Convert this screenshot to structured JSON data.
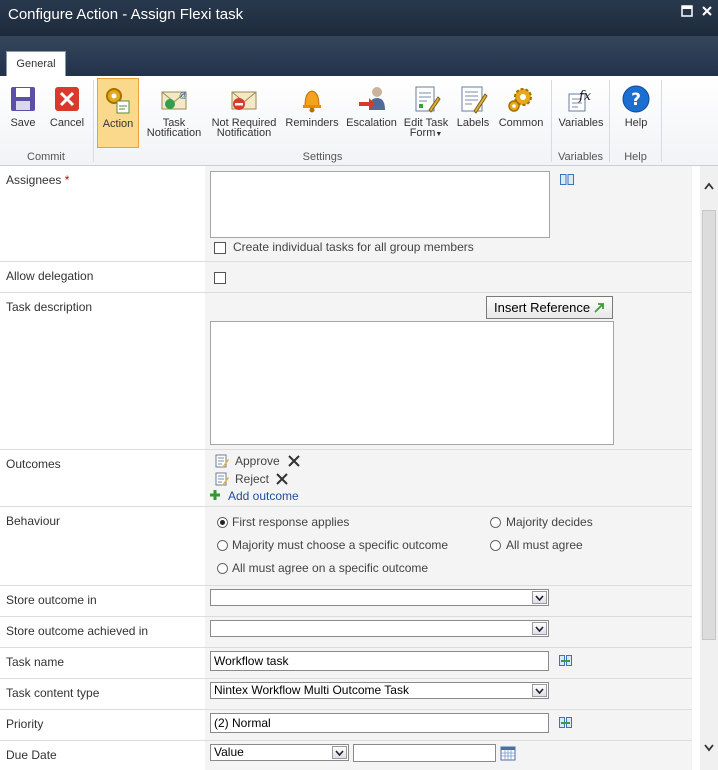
{
  "window": {
    "title": "Configure Action - Assign Flexi task"
  },
  "tabs": [
    {
      "label": "General"
    }
  ],
  "ribbon": {
    "groups": {
      "commit": "Commit",
      "settings": "Settings",
      "variables": "Variables",
      "help": "Help"
    },
    "buttons": {
      "save": "Save",
      "cancel": "Cancel",
      "action": "Action",
      "task_notification_1": "Task",
      "task_notification_2": "Notification",
      "not_required_1": "Not Required",
      "not_required_2": "Notification",
      "reminders": "Reminders",
      "escalation": "Escalation",
      "edit_task_form_1": "Edit Task",
      "edit_task_form_2": "Form",
      "labels": "Labels",
      "common": "Common",
      "variables": "Variables",
      "help": "Help"
    }
  },
  "form": {
    "assignees": {
      "label": "Assignees",
      "required_mark": "*",
      "checkbox_label": "Create individual tasks for all group members"
    },
    "allow_delegation": {
      "label": "Allow delegation"
    },
    "task_description": {
      "label": "Task description",
      "insert_reference": "Insert Reference"
    },
    "outcomes": {
      "label": "Outcomes",
      "items": [
        "Approve",
        "Reject"
      ],
      "add_label": "Add outcome"
    },
    "behaviour": {
      "label": "Behaviour",
      "options": [
        "First response applies",
        "Majority decides",
        "Majority must choose a specific outcome",
        "All must agree",
        "All must agree on a specific outcome"
      ],
      "selected": "First response applies"
    },
    "store_outcome_in": {
      "label": "Store outcome in",
      "value": ""
    },
    "store_outcome_achieved_in": {
      "label": "Store outcome achieved in",
      "value": ""
    },
    "task_name": {
      "label": "Task name",
      "value": "Workflow task"
    },
    "task_content_type": {
      "label": "Task content type",
      "value": "Nintex Workflow Multi Outcome Task"
    },
    "priority": {
      "label": "Priority",
      "value": "(2) Normal"
    },
    "due_date": {
      "label": "Due Date",
      "type_value": "Value",
      "date_value": ""
    }
  }
}
